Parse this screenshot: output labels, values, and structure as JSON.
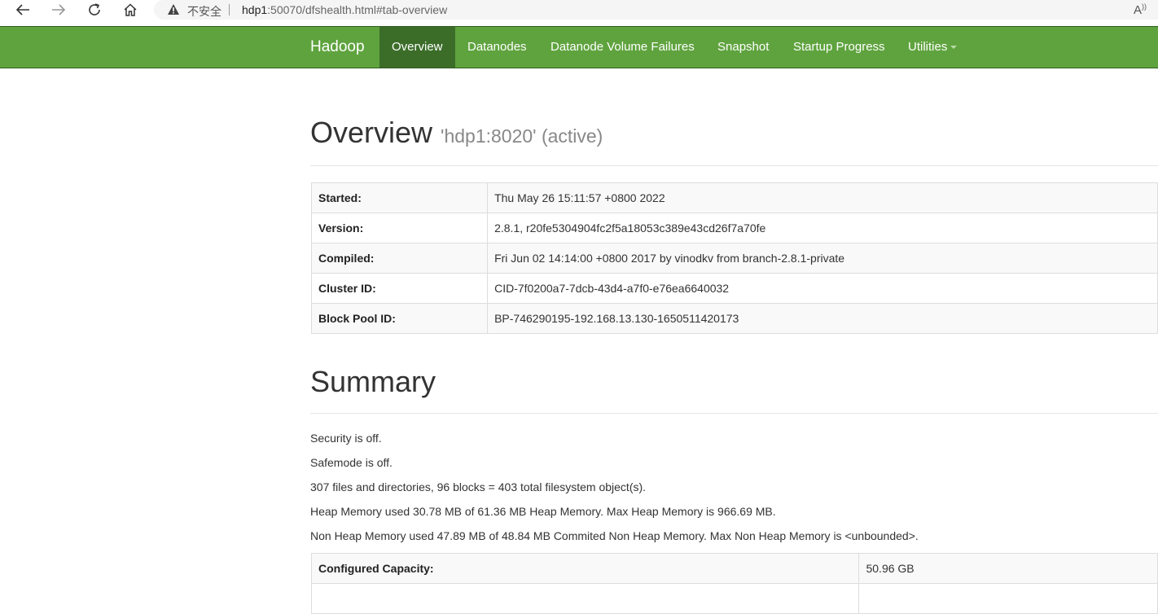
{
  "browser": {
    "insecure_label": "不安全",
    "url_host": "hdp1",
    "url_rest": ":50070/dfshealth.html#tab-overview",
    "read_aloud": "A"
  },
  "navbar": {
    "brand": "Hadoop",
    "items": [
      {
        "label": "Overview"
      },
      {
        "label": "Datanodes"
      },
      {
        "label": "Datanode Volume Failures"
      },
      {
        "label": "Snapshot"
      },
      {
        "label": "Startup Progress"
      },
      {
        "label": "Utilities"
      }
    ],
    "active_color": "#3b6d29",
    "bar_color": "#5fa33e"
  },
  "overview": {
    "title": "Overview",
    "subtitle": "'hdp1:8020' (active)",
    "rows": [
      {
        "key": "Started:",
        "value": "Thu May 26 15:11:57 +0800 2022"
      },
      {
        "key": "Version:",
        "value": "2.8.1, r20fe5304904fc2f5a18053c389e43cd26f7a70fe"
      },
      {
        "key": "Compiled:",
        "value": "Fri Jun 02 14:14:00 +0800 2017 by vinodkv from branch-2.8.1-private"
      },
      {
        "key": "Cluster ID:",
        "value": "CID-7f0200a7-7dcb-43d4-a7f0-e76ea6640032"
      },
      {
        "key": "Block Pool ID:",
        "value": "BP-746290195-192.168.13.130-1650511420173"
      }
    ]
  },
  "summary": {
    "title": "Summary",
    "lines": [
      "Security is off.",
      "Safemode is off.",
      "307 files and directories, 96 blocks = 403 total filesystem object(s).",
      "Heap Memory used 30.78 MB of 61.36 MB Heap Memory. Max Heap Memory is 966.69 MB.",
      "Non Heap Memory used 47.89 MB of 48.84 MB Commited Non Heap Memory. Max Non Heap Memory is <unbounded>."
    ],
    "table": [
      {
        "key": "Configured Capacity:",
        "value": "50.96 GB"
      },
      {
        "key": "",
        "value": ""
      }
    ]
  }
}
